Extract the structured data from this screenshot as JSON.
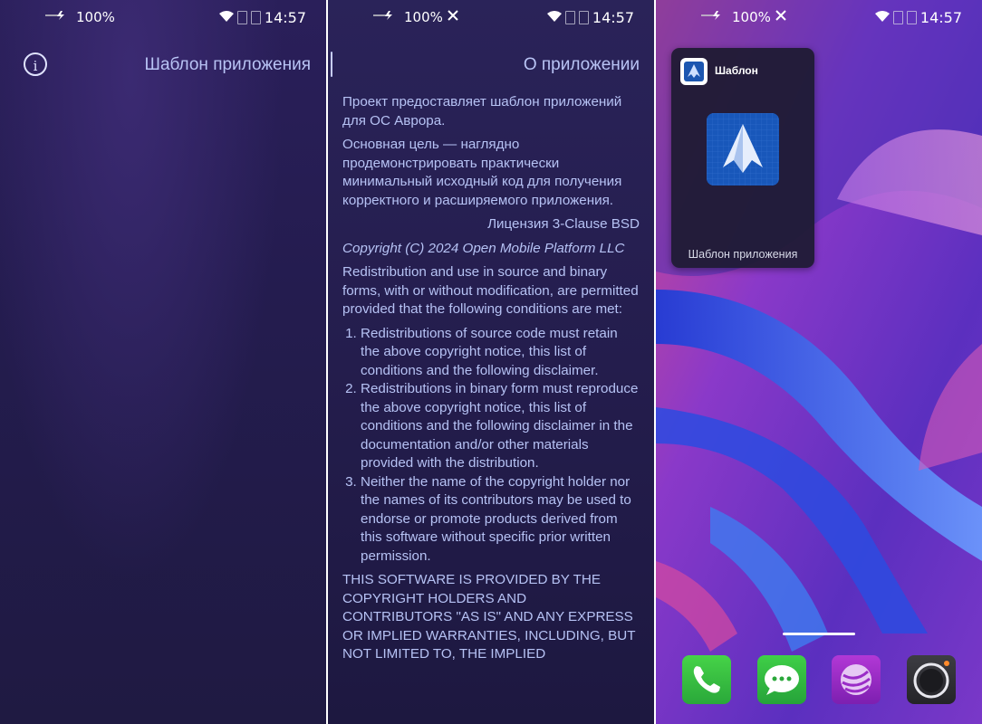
{
  "status_bar": {
    "battery": "100%",
    "time": "14:57"
  },
  "screen1": {
    "title": "Шаблон приложения"
  },
  "screen2": {
    "title": "О приложении",
    "intro1": "Проект предоставляет шаблон приложений для ОС Аврора.",
    "intro2": "Основная цель — наглядно продемонстрировать практически минимальный исходный код для получения корректного и расширяемого приложения.",
    "license": "Лицензия 3-Clause BSD",
    "copyright": "Copyright (C) 2024 Open Mobile Platform LLC",
    "redistribution": "Redistribution and use in source and binary forms, with or without modification, are permitted provided that the following conditions are met:",
    "conditions": [
      "Redistributions of source code must retain the above copyright notice, this list of conditions and the following disclaimer.",
      "Redistributions in binary form must reproduce the above copyright notice, this list of conditions and the following disclaimer in the documentation and/or other materials provided with the distribution.",
      "Neither the name of the copyright holder nor the names of its contributors may be used to endorse or promote products derived from this software without specific prior written permission."
    ],
    "disclaimer": "THIS SOFTWARE IS PROVIDED BY THE COPYRIGHT HOLDERS AND CONTRIBUTORS \"AS IS\" AND ANY EXPRESS OR IMPLIED WARRANTIES, INCLUDING, BUT NOT LIMITED TO, THE IMPLIED"
  },
  "screen3": {
    "widget_title": "Шаблон",
    "widget_caption": "Шаблон приложения",
    "dock": [
      "phone-icon",
      "messages-icon",
      "browser-icon",
      "camera-icon"
    ]
  },
  "colors": {
    "accent": "#b9c4f5",
    "text": "#b6c2f4",
    "phone_green": "#3cc443",
    "browser_purple": "#9a2cc7"
  }
}
